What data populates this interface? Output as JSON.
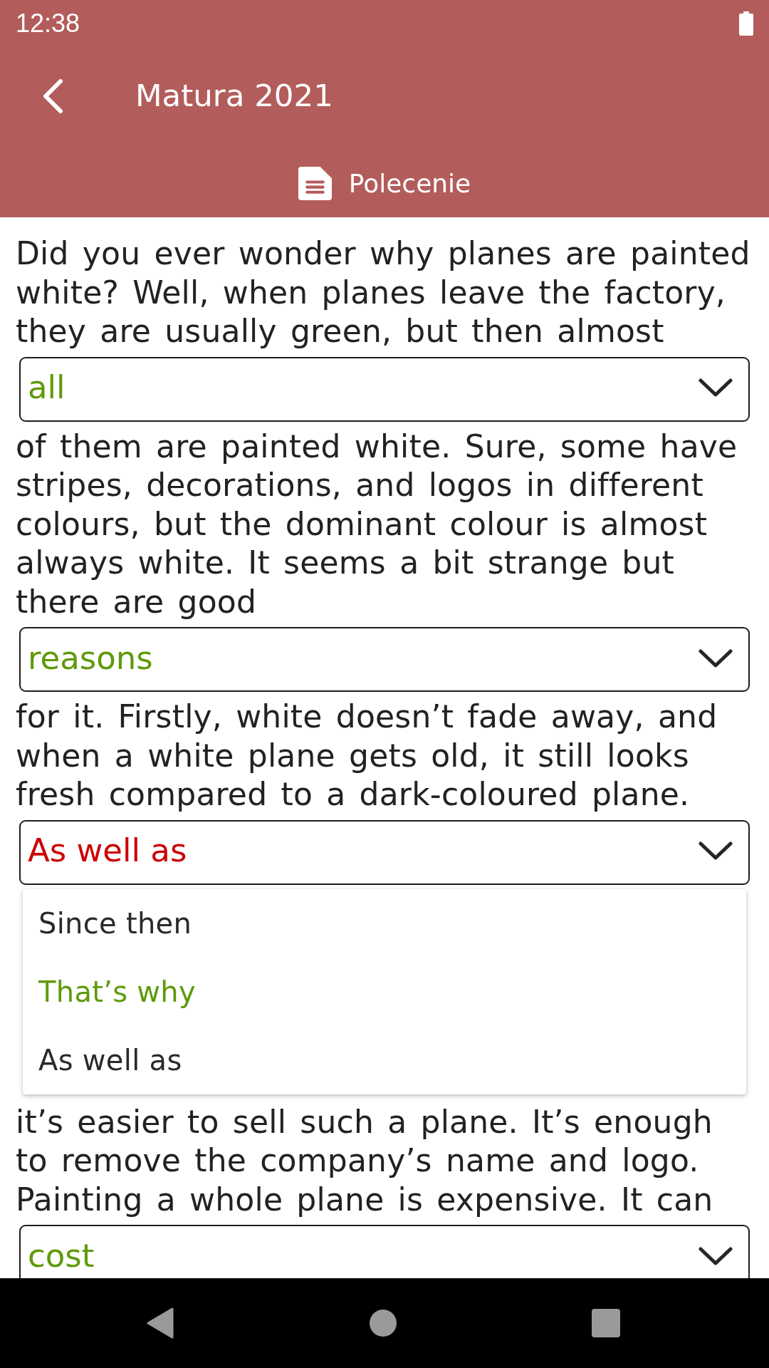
{
  "status_bar": {
    "time": "12:38"
  },
  "header": {
    "title": "Matura 2021",
    "tab": {
      "label": "Polecenie"
    }
  },
  "passage": [
    {
      "kind": "text",
      "text": "Did you ever wonder why planes are painted white? Well, when planes leave the factory, they are usually green, but then almost"
    },
    {
      "kind": "gap",
      "value": "all",
      "correct": true,
      "expanded": false
    },
    {
      "kind": "text",
      "text": "of them are painted white. Sure, some have stripes, decorations, and logos in different colours, but the dominant colour is almost always white. It seems a bit strange but there are good"
    },
    {
      "kind": "gap",
      "value": "reasons",
      "correct": true,
      "expanded": false
    },
    {
      "kind": "text",
      "text": "for it. Firstly, white doesn’t fade away, and when a white plane gets old, it still looks fresh compared to a dark-coloured plane."
    },
    {
      "kind": "gap",
      "value": "As well as",
      "correct": false,
      "expanded": true,
      "options": [
        {
          "label": "Since then",
          "correct": false
        },
        {
          "label": "That’s why",
          "correct": true
        },
        {
          "label": "As well as",
          "correct": false
        }
      ]
    },
    {
      "kind": "text",
      "text": "it’s easier to sell such a plane. It’s enough to remove the company’s name and logo. Painting a whole plane is expensive. It can"
    },
    {
      "kind": "gap",
      "value": "cost",
      "correct": true,
      "expanded": false
    }
  ]
}
